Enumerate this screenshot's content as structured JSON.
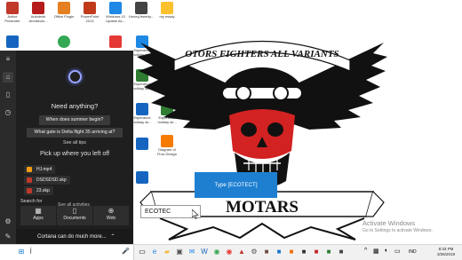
{
  "desktop_icons": [
    {
      "label": "Active Presenter",
      "color": "#c0392b"
    },
    {
      "label": "Autodesk Architectu...",
      "color": "#b71c1c"
    },
    {
      "label": "Office Plugin",
      "color": "#e67e22"
    },
    {
      "label": "PowerPoint 2013",
      "color": "#c13b1b"
    },
    {
      "label": "Windows 10 Update As...",
      "color": "#1e88e5"
    },
    {
      "label": "HoneyJewelry...",
      "color": "#444444"
    },
    {
      "label": "my essay",
      "color": "#fbc02d"
    }
  ],
  "side_icons": [
    {
      "label": "Esperance holiday sk...",
      "color": "#1e88e5"
    },
    {
      "label": "Esperance holiday sk...",
      "color": "#2e7d32"
    },
    {
      "label": "Esperance holiday sk...",
      "color": "#1565c0"
    },
    {
      "label": "Esperance holiday sk...",
      "color": "#2e7d32"
    },
    {
      "label": "Diagram of Flow Design",
      "color": "#f57c00"
    }
  ],
  "logo": {
    "banner_top": "OTORS FIGHTERS ALL VARIANTS",
    "banner_bottom": "MOTARS"
  },
  "cortana": {
    "heading": "Need anything?",
    "suggestions": [
      "When does summer begin?",
      "What gate is Delta flight 35 arriving at?"
    ],
    "see_all_tips": "See all tips",
    "pickup_heading": "Pick up where you left off",
    "recent_files": [
      {
        "name": "HJ.mp4",
        "color": "#f39c12"
      },
      {
        "name": "DSDSDSD.skp",
        "color": "#c0392b"
      },
      {
        "name": "23.skp",
        "color": "#c0392b"
      }
    ],
    "search_for": "Search for",
    "see_all_activities": "See all activities",
    "tiles": [
      {
        "label": "Apps",
        "icon": "apps-grid-icon",
        "glyph": "▦"
      },
      {
        "label": "Documents",
        "icon": "document-icon",
        "glyph": "▯"
      },
      {
        "label": "Web",
        "icon": "globe-icon",
        "glyph": "⊕"
      }
    ],
    "can_do_more": "Cortana can do much more...",
    "chevron": "⌃"
  },
  "tooltip": {
    "text": "Type [ECOTECT]"
  },
  "text_box": {
    "value": "ECOTEC"
  },
  "watermark": {
    "line1": "Activate Windows",
    "line2": "Go to Settings to activate Windows."
  },
  "taskbar": {
    "search_text": "j",
    "mic": "🎤",
    "language": "IND",
    "time": "8:33 PM",
    "date": "3/26/2019",
    "chevron": "^"
  },
  "colors": {
    "cortana_bg": "#1f1f1f",
    "accent_blue": "#1e7fd1",
    "ring": "#9aa7ff"
  }
}
